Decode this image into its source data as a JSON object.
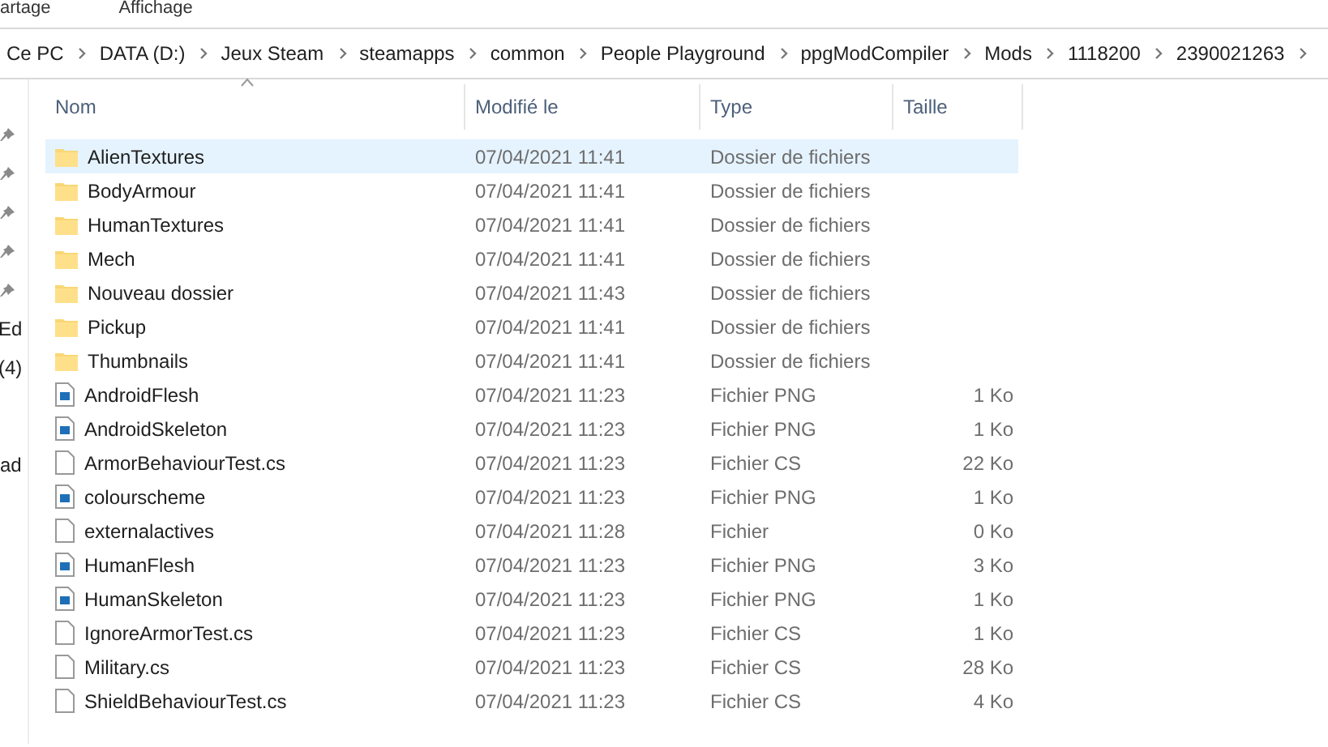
{
  "ribbon_tabs": [
    "artage",
    "Affichage"
  ],
  "breadcrumb": [
    "Ce PC",
    "DATA (D:)",
    "Jeux Steam",
    "steamapps",
    "common",
    "People Playground",
    "ppgModCompiler",
    "Mods",
    "1118200",
    "2390021263"
  ],
  "nav_pane": {
    "quick_access": [
      {
        "pinned": true
      },
      {
        "pinned": true
      },
      {
        "pinned": true
      },
      {
        "pinned": true
      },
      {
        "pinned": true
      },
      {
        "label": "Ed",
        "pinned": false
      },
      {
        "label": "(4)",
        "pinned": false
      }
    ],
    "other": [
      {
        "label": "ad"
      }
    ]
  },
  "columns": [
    {
      "label": "Nom",
      "sorted": true
    },
    {
      "label": "Modifié le",
      "sorted": false
    },
    {
      "label": "Type",
      "sorted": false
    },
    {
      "label": "Taille",
      "sorted": false
    }
  ],
  "rows": [
    {
      "kind": "folder",
      "name": "AlienTextures",
      "modified": "07/04/2021 11:41",
      "type": "Dossier de fichiers",
      "selected": true
    },
    {
      "kind": "folder",
      "name": "BodyArmour",
      "modified": "07/04/2021 11:41",
      "type": "Dossier de fichiers",
      "selected": false
    },
    {
      "kind": "folder",
      "name": "HumanTextures",
      "modified": "07/04/2021 11:41",
      "type": "Dossier de fichiers",
      "selected": false
    },
    {
      "kind": "folder",
      "name": "Mech",
      "modified": "07/04/2021 11:41",
      "type": "Dossier de fichiers",
      "selected": false
    },
    {
      "kind": "folder",
      "name": "Nouveau dossier",
      "modified": "07/04/2021 11:43",
      "type": "Dossier de fichiers",
      "selected": false
    },
    {
      "kind": "folder",
      "name": "Pickup",
      "modified": "07/04/2021 11:41",
      "type": "Dossier de fichiers",
      "selected": false
    },
    {
      "kind": "folder",
      "name": "Thumbnails",
      "modified": "07/04/2021 11:41",
      "type": "Dossier de fichiers",
      "selected": false
    },
    {
      "kind": "image",
      "name": "AndroidFlesh",
      "modified": "07/04/2021 11:23",
      "type": "Fichier PNG",
      "size": "1 Ko",
      "selected": false
    },
    {
      "kind": "image",
      "name": "AndroidSkeleton",
      "modified": "07/04/2021 11:23",
      "type": "Fichier PNG",
      "size": "1 Ko",
      "selected": false
    },
    {
      "kind": "file",
      "name": "ArmorBehaviourTest.cs",
      "modified": "07/04/2021 11:23",
      "type": "Fichier CS",
      "size": "22 Ko",
      "selected": false
    },
    {
      "kind": "image",
      "name": "colourscheme",
      "modified": "07/04/2021 11:23",
      "type": "Fichier PNG",
      "size": "1 Ko",
      "selected": false
    },
    {
      "kind": "file",
      "name": "externalactives",
      "modified": "07/04/2021 11:28",
      "type": "Fichier",
      "size": "0 Ko",
      "selected": false
    },
    {
      "kind": "image",
      "name": "HumanFlesh",
      "modified": "07/04/2021 11:23",
      "type": "Fichier PNG",
      "size": "3 Ko",
      "selected": false
    },
    {
      "kind": "image",
      "name": "HumanSkeleton",
      "modified": "07/04/2021 11:23",
      "type": "Fichier PNG",
      "size": "1 Ko",
      "selected": false
    },
    {
      "kind": "file",
      "name": "IgnoreArmorTest.cs",
      "modified": "07/04/2021 11:23",
      "type": "Fichier CS",
      "size": "1 Ko",
      "selected": false
    },
    {
      "kind": "file",
      "name": "Military.cs",
      "modified": "07/04/2021 11:23",
      "type": "Fichier CS",
      "size": "28 Ko",
      "selected": false
    },
    {
      "kind": "file",
      "name": "ShieldBehaviourTest.cs",
      "modified": "07/04/2021 11:23",
      "type": "Fichier CS",
      "size": "4 Ko",
      "selected": false
    }
  ]
}
